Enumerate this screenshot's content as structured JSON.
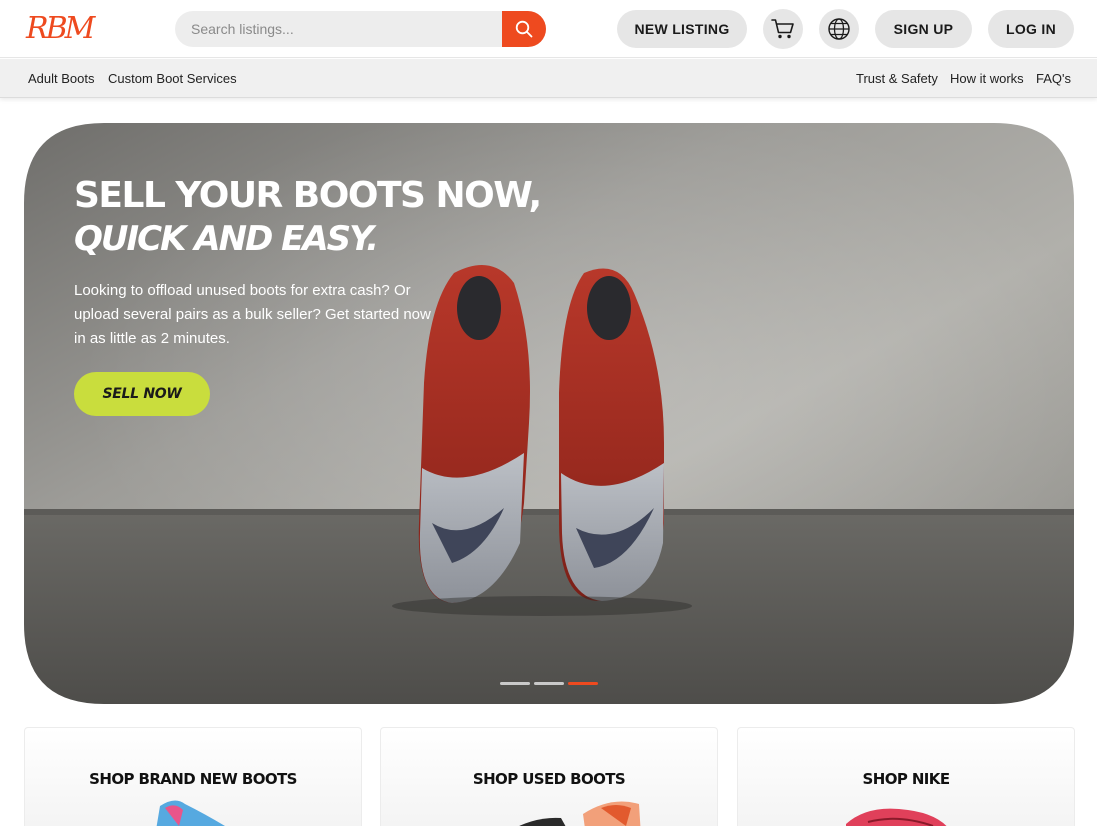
{
  "header": {
    "logo_text": "RBM",
    "search_placeholder": "Search listings...",
    "new_listing_label": "NEW LISTING",
    "sign_up_label": "SIGN UP",
    "log_in_label": "LOG IN",
    "icons": [
      "search-icon",
      "cart-icon",
      "globe-icon"
    ],
    "accent_color": "#ee4a1f"
  },
  "subnav": {
    "left_links": [
      "Adult Boots",
      "Custom Boot Services"
    ],
    "right_links": [
      "Trust & Safety",
      "How it works",
      "FAQ's"
    ]
  },
  "hero": {
    "title_line1": "SELL YOUR BOOTS NOW,",
    "title_line2": "QUICK AND EASY.",
    "body": "Looking to offload unused boots for extra cash? Or upload several pairs as a bulk seller? Get started now in as little as 2 minutes.",
    "cta_label": "SELL NOW",
    "cta_color": "#c9dd3d",
    "slides_count": 3,
    "active_slide": 3
  },
  "categories": [
    {
      "title": "SHOP BRAND NEW BOOTS"
    },
    {
      "title": "SHOP USED BOOTS"
    },
    {
      "title": "SHOP NIKE"
    }
  ]
}
